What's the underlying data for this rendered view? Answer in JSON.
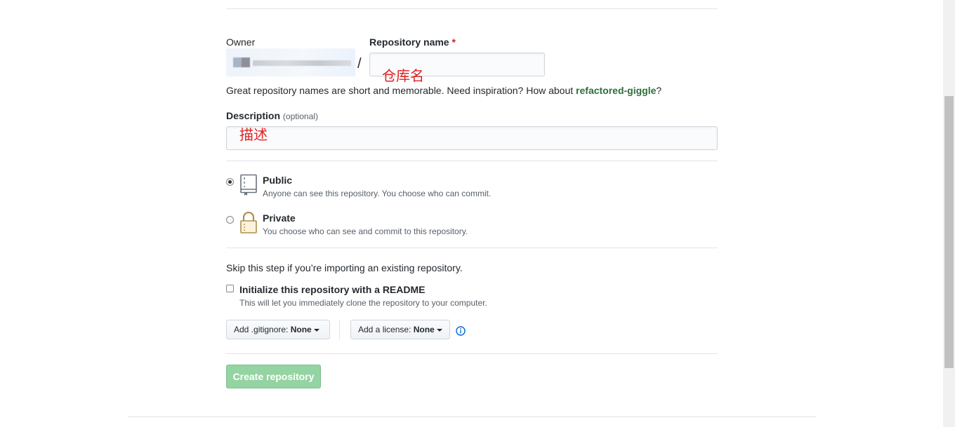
{
  "form": {
    "owner_label": "Owner",
    "repo_label": "Repository name",
    "required_mark": "*",
    "slash": "/",
    "repo_annotation": "仓库名",
    "hint_prefix": "Great repository names are short and memorable. Need inspiration? How about ",
    "hint_suggestion": "refactored-giggle",
    "hint_suffix": "?",
    "description_label": "Description",
    "description_optional": "(optional)",
    "description_annotation": "描述",
    "visibility": {
      "public_title": "Public",
      "public_note": "Anyone can see this repository. You choose who can commit.",
      "private_title": "Private",
      "private_note": "You choose who can see and commit to this repository.",
      "selected": "public"
    },
    "skip_text": "Skip this step if you’re importing an existing repository.",
    "readme_label": "Initialize this repository with a README",
    "readme_note": "This will let you immediately clone the repository to your computer.",
    "gitignore_prefix": "Add .gitignore: ",
    "gitignore_value": "None",
    "license_prefix": "Add a license: ",
    "license_value": "None",
    "create_button": "Create repository"
  },
  "colors": {
    "annotation": "#e02020",
    "create_button": "#94d3a2",
    "info_icon": "#0366d6"
  }
}
